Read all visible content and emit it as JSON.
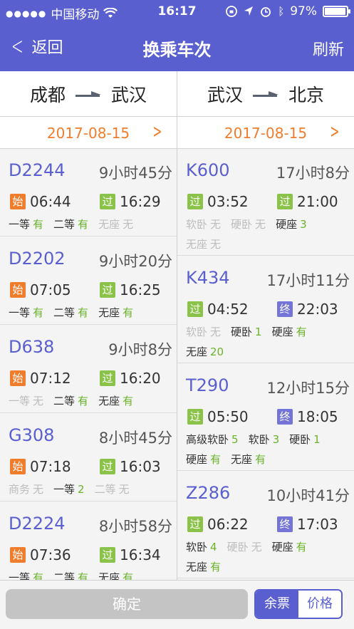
{
  "status": {
    "carrier": "中国移动",
    "time": "16:17",
    "battery": "97%",
    "battery_level": 0.97
  },
  "nav": {
    "back": "返回",
    "title": "换乘车次",
    "refresh": "刷新"
  },
  "left": {
    "from": "成都",
    "to": "武汉",
    "date": "2017-08-15",
    "trains": [
      {
        "num": "D2244",
        "dur": "9小时45分",
        "dep_tag": "始",
        "dep_kind": "start",
        "dep": "06:44",
        "arr_tag": "过",
        "arr_kind": "pass",
        "arr": "16:29",
        "seats": [
          {
            "n": "一等",
            "v": "有",
            "av": true
          },
          {
            "n": "二等",
            "v": "有",
            "av": true
          },
          {
            "n": "无座",
            "v": "无",
            "av": false
          }
        ]
      },
      {
        "num": "D2202",
        "dur": "9小时20分",
        "dep_tag": "始",
        "dep_kind": "start",
        "dep": "07:05",
        "arr_tag": "过",
        "arr_kind": "pass",
        "arr": "16:25",
        "seats": [
          {
            "n": "一等",
            "v": "有",
            "av": true
          },
          {
            "n": "二等",
            "v": "有",
            "av": true
          },
          {
            "n": "无座",
            "v": "有",
            "av": true
          }
        ]
      },
      {
        "num": "D638",
        "dur": "9小时8分",
        "dep_tag": "始",
        "dep_kind": "start",
        "dep": "07:12",
        "arr_tag": "过",
        "arr_kind": "pass",
        "arr": "16:20",
        "seats": [
          {
            "n": "一等",
            "v": "无",
            "av": false
          },
          {
            "n": "二等",
            "v": "有",
            "av": true
          },
          {
            "n": "无座",
            "v": "有",
            "av": true
          }
        ]
      },
      {
        "num": "G308",
        "dur": "8小时45分",
        "dep_tag": "始",
        "dep_kind": "start",
        "dep": "07:18",
        "arr_tag": "过",
        "arr_kind": "pass",
        "arr": "16:03",
        "seats": [
          {
            "n": "商务",
            "v": "无",
            "av": false
          },
          {
            "n": "一等",
            "v": "2",
            "av": true
          },
          {
            "n": "二等",
            "v": "无",
            "av": false
          }
        ]
      },
      {
        "num": "D2224",
        "dur": "8小时58分",
        "dep_tag": "始",
        "dep_kind": "start",
        "dep": "07:36",
        "arr_tag": "过",
        "arr_kind": "pass",
        "arr": "16:34",
        "seats": [
          {
            "n": "一等",
            "v": "有",
            "av": true
          },
          {
            "n": "二等",
            "v": "有",
            "av": true
          },
          {
            "n": "无座",
            "v": "有",
            "av": true
          }
        ]
      }
    ]
  },
  "right": {
    "from": "武汉",
    "to": "北京",
    "date": "2017-08-15",
    "trains": [
      {
        "num": "K600",
        "dur": "17小时8分",
        "dep_tag": "过",
        "dep_kind": "pass",
        "dep": "03:52",
        "arr_tag": "过",
        "arr_kind": "pass",
        "arr": "21:00",
        "seats": [
          {
            "n": "软卧",
            "v": "无",
            "av": false
          },
          {
            "n": "硬卧",
            "v": "无",
            "av": false
          },
          {
            "n": "硬座",
            "v": "3",
            "av": true
          },
          {
            "n": "无座",
            "v": "无",
            "av": false
          }
        ]
      },
      {
        "num": "K434",
        "dur": "17小时11分",
        "dep_tag": "过",
        "dep_kind": "pass",
        "dep": "04:52",
        "arr_tag": "终",
        "arr_kind": "end",
        "arr": "22:03",
        "seats": [
          {
            "n": "软卧",
            "v": "无",
            "av": false
          },
          {
            "n": "硬卧",
            "v": "1",
            "av": true
          },
          {
            "n": "硬座",
            "v": "有",
            "av": true
          },
          {
            "n": "无座",
            "v": "20",
            "av": true
          }
        ]
      },
      {
        "num": "T290",
        "dur": "12小时15分",
        "dep_tag": "过",
        "dep_kind": "pass",
        "dep": "05:50",
        "arr_tag": "终",
        "arr_kind": "end",
        "arr": "18:05",
        "seats": [
          {
            "n": "高级软卧",
            "v": "5",
            "av": true
          },
          {
            "n": "软卧",
            "v": "3",
            "av": true
          },
          {
            "n": "硬卧",
            "v": "1",
            "av": true
          },
          {
            "n": "硬座",
            "v": "有",
            "av": true
          },
          {
            "n": "无座",
            "v": "有",
            "av": true
          }
        ]
      },
      {
        "num": "Z286",
        "dur": "10小时41分",
        "dep_tag": "过",
        "dep_kind": "pass",
        "dep": "06:22",
        "arr_tag": "终",
        "arr_kind": "end",
        "arr": "17:03",
        "seats": [
          {
            "n": "软卧",
            "v": "4",
            "av": true
          },
          {
            "n": "硬卧",
            "v": "无",
            "av": false
          },
          {
            "n": "硬座",
            "v": "有",
            "av": true
          },
          {
            "n": "无座",
            "v": "有",
            "av": true
          }
        ]
      }
    ]
  },
  "bottom": {
    "confirm": "确定",
    "tab_tickets": "余票",
    "tab_price": "价格"
  },
  "colors": {
    "accent": "#5a5fd0",
    "orange": "#f07d2c",
    "green": "#8bc34a",
    "available": "#6ab42a"
  }
}
